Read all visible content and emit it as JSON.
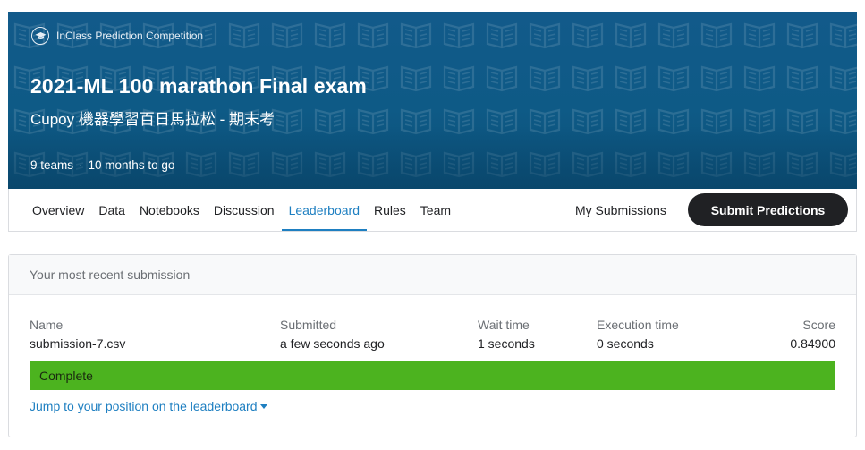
{
  "banner": {
    "competition_type": "InClass Prediction Competition",
    "competition_icon": "graduation-cap-icon",
    "title": "2021-ML 100 marathon Final exam",
    "subtitle": "Cupoy 機器學習百日馬拉松 - 期末考",
    "teams": "9 teams",
    "separator": "·",
    "time_left": "10 months to go",
    "bg_color": "#0e5a86"
  },
  "nav": {
    "tabs": [
      {
        "label": "Overview"
      },
      {
        "label": "Data"
      },
      {
        "label": "Notebooks"
      },
      {
        "label": "Discussion"
      },
      {
        "label": "Leaderboard",
        "active": true
      },
      {
        "label": "Rules"
      },
      {
        "label": "Team"
      }
    ],
    "my_submissions": "My Submissions",
    "submit_label": "Submit Predictions",
    "active_color": "#1e7fc1"
  },
  "submission": {
    "header": "Your most recent submission",
    "columns": [
      {
        "label": "Name",
        "value": "submission-7.csv"
      },
      {
        "label": "Submitted",
        "value": "a few seconds ago"
      },
      {
        "label": "Wait time",
        "value": "1 seconds"
      },
      {
        "label": "Execution time",
        "value": "0 seconds"
      },
      {
        "label": "Score",
        "value": "0.84900"
      }
    ],
    "status": "Complete",
    "status_color": "#4cb31f",
    "jump_link": "Jump to your position on the leaderboard"
  }
}
